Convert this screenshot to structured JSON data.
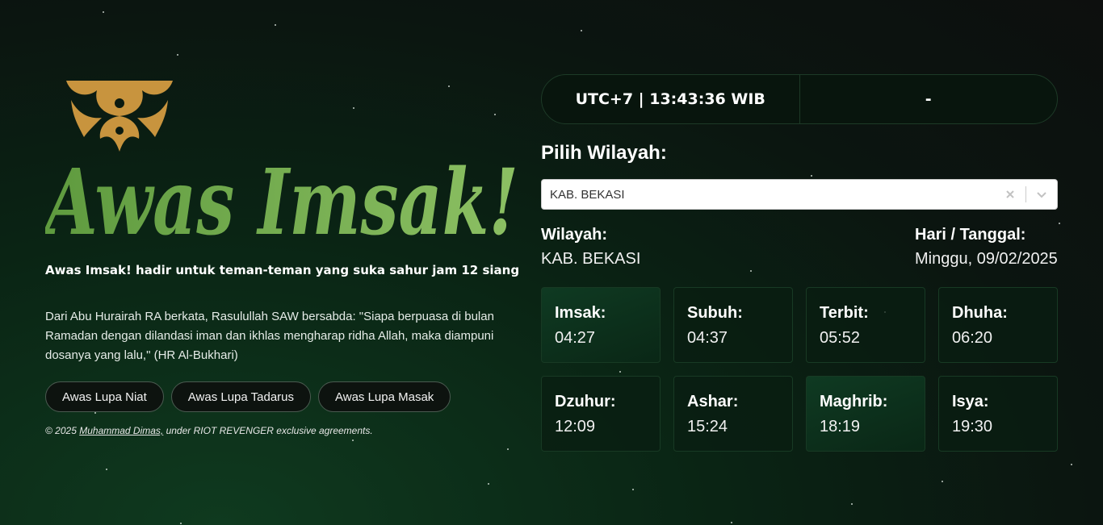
{
  "brand": {
    "logo_text": "Awas Imsak!",
    "tagline": "Awas Imsak! hadir untuk teman-teman yang suka sahur jam 12 siang",
    "hadith": "Dari Abu Hurairah RA berkata, Rasulullah SAW bersabda: \"Siapa berpuasa di bulan Ramadan dengan dilandasi iman dan ikhlas mengharap ridha Allah, maka diampuni dosanya yang lalu,\" (HR Al-Bukhari)"
  },
  "links": [
    {
      "label": "Awas Lupa Niat"
    },
    {
      "label": "Awas Lupa Tadarus"
    },
    {
      "label": "Awas Lupa Masak"
    }
  ],
  "footer": {
    "prefix": "© 2025 ",
    "author": "Muhammad Dimas,",
    "suffix": " under RIOT REVENGER exclusive agreements."
  },
  "clock": {
    "time": "UTC+7 | 13:43:36 WIB",
    "status": "-"
  },
  "region_picker": {
    "label": "Pilih Wilayah:",
    "selected": "KAB. BEKASI"
  },
  "info": {
    "region_label": "Wilayah:",
    "region_value": "KAB. BEKASI",
    "date_label": "Hari / Tanggal:",
    "date_value": "Minggu, 09/02/2025"
  },
  "prayers": [
    {
      "name": "Imsak:",
      "time": "04:27"
    },
    {
      "name": "Subuh:",
      "time": "04:37"
    },
    {
      "name": "Terbit:",
      "time": "05:52"
    },
    {
      "name": "Dhuha:",
      "time": "06:20"
    },
    {
      "name": "Dzuhur:",
      "time": "12:09"
    },
    {
      "name": "Ashar:",
      "time": "15:24"
    },
    {
      "name": "Maghrib:",
      "time": "18:19"
    },
    {
      "name": "Isya:",
      "time": "19:30"
    }
  ],
  "colors": {
    "accent_green": "#7fb35a",
    "ornament_gold": "#c8943e",
    "card_border": "#183a24"
  },
  "icons": [
    "mandala-ornament-icon",
    "clear-icon",
    "chevron-down-icon"
  ]
}
